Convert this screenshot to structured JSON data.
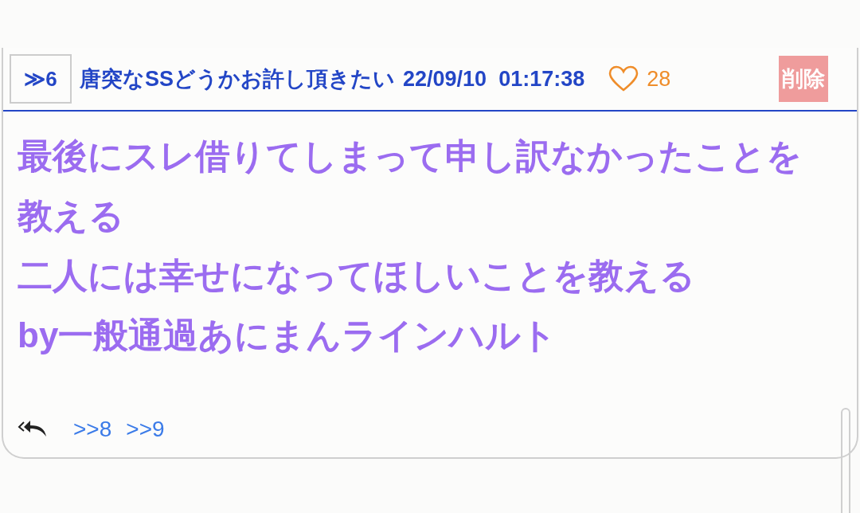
{
  "post": {
    "number_label": "≫6",
    "title": "唐突なSSどうかお許し頂きたい",
    "datetime": "22/09/10  01:17:38",
    "likes": "28",
    "delete_label": "削除"
  },
  "body_lines": [
    "最後にスレ借りてしまって申し訳なかったことを教える",
    "二人には幸せになってほしいことを教える",
    "by一般通過あにまんラインハルト"
  ],
  "replies": [
    ">>8",
    ">>9"
  ]
}
